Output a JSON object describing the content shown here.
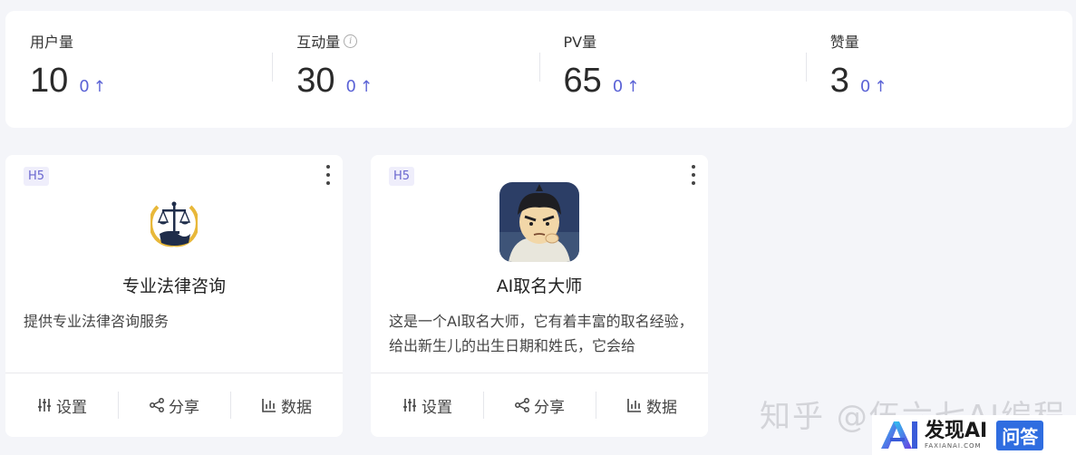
{
  "stats": [
    {
      "label": "用户量",
      "value": "10",
      "delta": "0",
      "info": false
    },
    {
      "label": "互动量",
      "value": "30",
      "delta": "0",
      "info": true
    },
    {
      "label": "PV量",
      "value": "65",
      "delta": "0",
      "info": false
    },
    {
      "label": "赞量",
      "value": "3",
      "delta": "0",
      "info": false
    }
  ],
  "cards": [
    {
      "badge": "H5",
      "title": "专业法律咨询",
      "desc": "提供专业法律咨询服务",
      "icon": "scales-of-justice-icon",
      "actions": {
        "settings": "设置",
        "share": "分享",
        "data": "数据"
      }
    },
    {
      "badge": "H5",
      "title": "AI取名大师",
      "desc": "这是一个AI取名大师，它有着丰富的取名经验，给出新生儿的出生日期和姓氏，它会给",
      "icon": "cartoon-avatar-icon",
      "actions": {
        "settings": "设置",
        "share": "分享",
        "data": "数据"
      }
    }
  ],
  "watermark": {
    "text": "知乎 @伍六七AI编程",
    "brand": "发现AI",
    "brand_sub": "FAXIANAI.COM",
    "qa": "问答"
  },
  "colors": {
    "accent": "#5b63d6",
    "background": "#f4f5f9",
    "badge_bg": "#efeefb"
  }
}
